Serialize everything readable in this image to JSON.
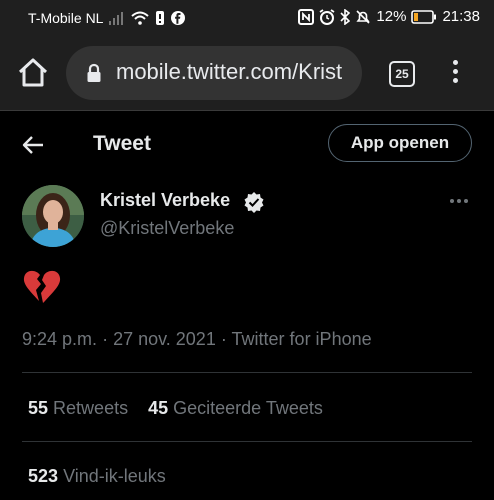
{
  "status_bar": {
    "carrier": "T-Mobile NL",
    "battery_percent": "12%",
    "time": "21:38"
  },
  "browser": {
    "url": "mobile.twitter.com/Krist",
    "tab_count": "25"
  },
  "header": {
    "title": "Tweet",
    "app_button": "App openen"
  },
  "tweet": {
    "author_name": "Kristel Verbeke",
    "author_handle": "@KristelVerbeke",
    "content_emoji": "broken-heart",
    "time": "9:24 p.m.",
    "date": "27 nov. 2021",
    "source": "Twitter for iPhone",
    "separator": "·",
    "retweets": "55",
    "retweets_label": "Retweets",
    "quotes": "45",
    "quotes_label": "Geciteerde Tweets",
    "likes": "523",
    "likes_label": "Vind-ik-leuks"
  },
  "colors": {
    "background": "#000000",
    "primary_text": "#e7e9ea",
    "secondary_text": "#71767b",
    "emoji_red": "#d93a3a"
  }
}
